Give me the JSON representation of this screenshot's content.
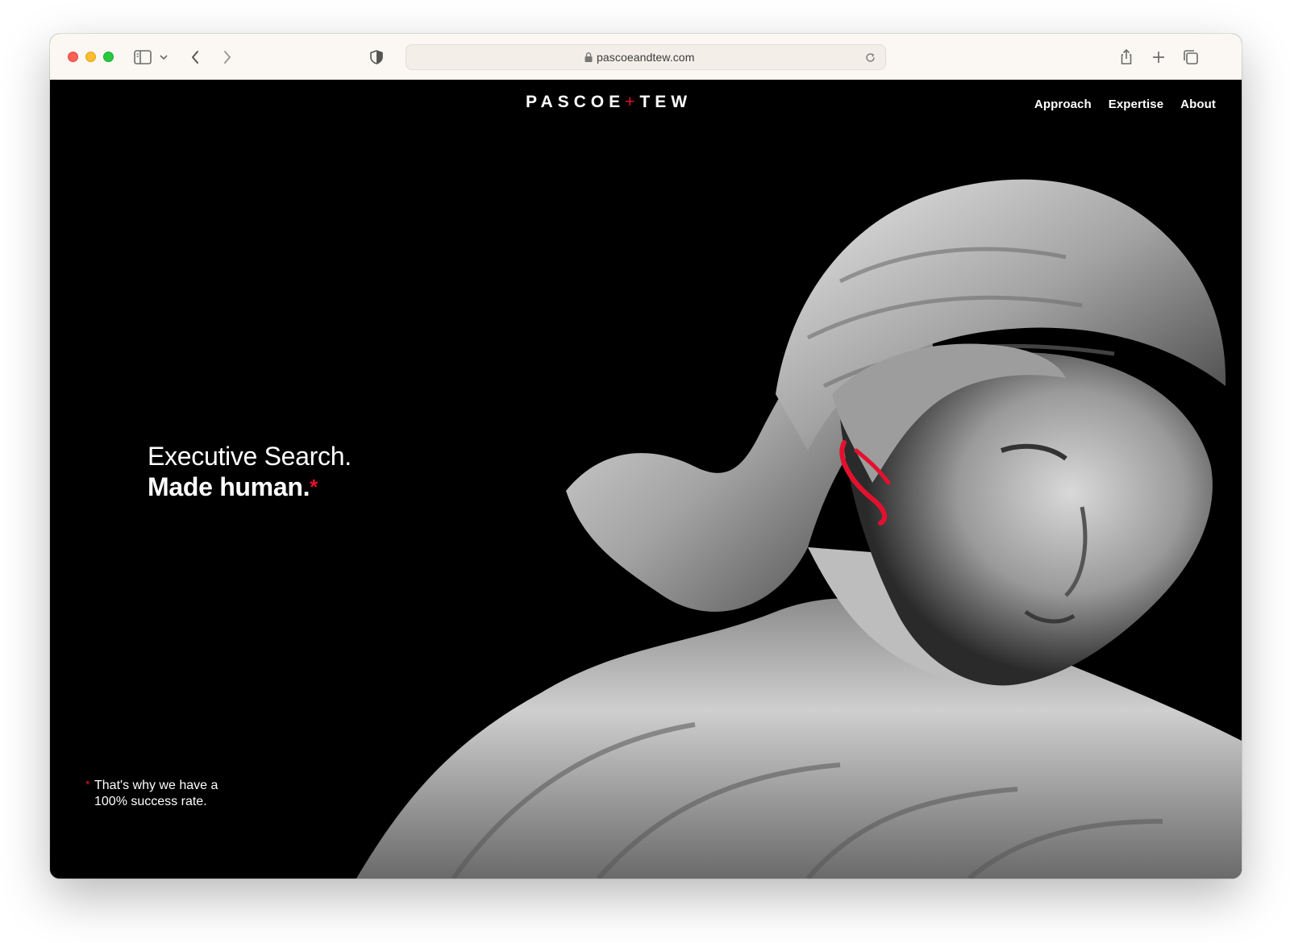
{
  "browser": {
    "url": "pascoeandtew.com",
    "icons": [
      "sidebar-icon",
      "chevron-down-icon",
      "back-icon",
      "forward-icon",
      "shield-icon",
      "lock-icon",
      "reload-icon",
      "share-icon",
      "new-tab-icon",
      "tabs-overview-icon"
    ]
  },
  "site": {
    "logo_left": "PASCOE",
    "logo_plus": "+",
    "logo_right": "TEW",
    "nav": [
      "Approach",
      "Expertise",
      "About"
    ],
    "hero_line1": "Executive Search.",
    "hero_line2": "Made human.",
    "hero_star": "*",
    "footnote_star": "*",
    "footnote_text": "That's why we have a 100% success rate."
  },
  "colors": {
    "accent": "#e4112e",
    "background": "#000000",
    "toolbar": "#fbf8f3"
  }
}
